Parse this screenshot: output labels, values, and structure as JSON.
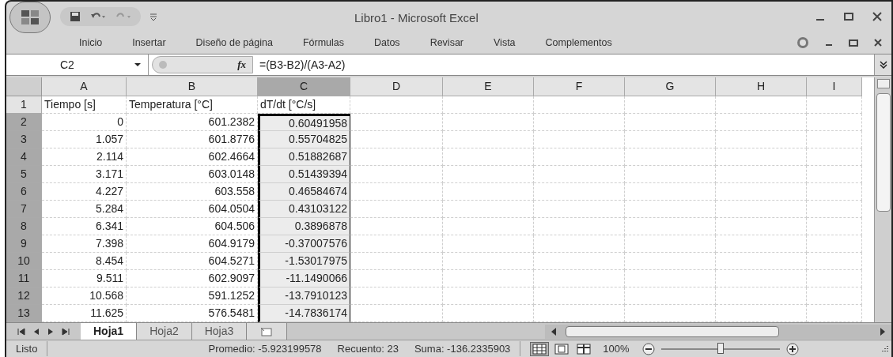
{
  "window": {
    "title": "Libro1 - Microsoft Excel"
  },
  "ribbon_tabs": [
    {
      "label": "Inicio"
    },
    {
      "label": "Insertar"
    },
    {
      "label": "Diseño de página"
    },
    {
      "label": "Fórmulas"
    },
    {
      "label": "Datos"
    },
    {
      "label": "Revisar"
    },
    {
      "label": "Vista"
    },
    {
      "label": "Complementos"
    }
  ],
  "formula_bar": {
    "name_box": "C2",
    "fx": "fx",
    "formula": "=(B3-B2)/(A3-A2)"
  },
  "columns": [
    {
      "label": "A",
      "selected": false
    },
    {
      "label": "B",
      "selected": false
    },
    {
      "label": "C",
      "selected": true
    },
    {
      "label": "D",
      "selected": false
    },
    {
      "label": "E",
      "selected": false
    },
    {
      "label": "F",
      "selected": false
    },
    {
      "label": "G",
      "selected": false
    },
    {
      "label": "H",
      "selected": false
    },
    {
      "label": "I",
      "selected": false
    }
  ],
  "rows": [
    {
      "label": "1",
      "selected": false,
      "cells": [
        {
          "text": "Tiempo [s]",
          "kind": "text"
        },
        {
          "text": "Temperatura [°C]",
          "kind": "text"
        },
        {
          "text": "dT/dt [°C/s]",
          "kind": "text"
        }
      ]
    },
    {
      "label": "2",
      "selected": true,
      "cells": [
        {
          "text": "0",
          "kind": "number"
        },
        {
          "text": "601.2382",
          "kind": "number"
        },
        {
          "text": "0.60491958",
          "kind": "number"
        }
      ]
    },
    {
      "label": "3",
      "selected": true,
      "cells": [
        {
          "text": "1.057",
          "kind": "number"
        },
        {
          "text": "601.8776",
          "kind": "number"
        },
        {
          "text": "0.55704825",
          "kind": "number"
        }
      ]
    },
    {
      "label": "4",
      "selected": true,
      "cells": [
        {
          "text": "2.114",
          "kind": "number"
        },
        {
          "text": "602.4664",
          "kind": "number"
        },
        {
          "text": "0.51882687",
          "kind": "number"
        }
      ]
    },
    {
      "label": "5",
      "selected": true,
      "cells": [
        {
          "text": "3.171",
          "kind": "number"
        },
        {
          "text": "603.0148",
          "kind": "number"
        },
        {
          "text": "0.51439394",
          "kind": "number"
        }
      ]
    },
    {
      "label": "6",
      "selected": true,
      "cells": [
        {
          "text": "4.227",
          "kind": "number"
        },
        {
          "text": "603.558",
          "kind": "number"
        },
        {
          "text": "0.46584674",
          "kind": "number"
        }
      ]
    },
    {
      "label": "7",
      "selected": true,
      "cells": [
        {
          "text": "5.284",
          "kind": "number"
        },
        {
          "text": "604.0504",
          "kind": "number"
        },
        {
          "text": "0.43103122",
          "kind": "number"
        }
      ]
    },
    {
      "label": "8",
      "selected": true,
      "cells": [
        {
          "text": "6.341",
          "kind": "number"
        },
        {
          "text": "604.506",
          "kind": "number"
        },
        {
          "text": "0.3896878",
          "kind": "number"
        }
      ]
    },
    {
      "label": "9",
      "selected": true,
      "cells": [
        {
          "text": "7.398",
          "kind": "number"
        },
        {
          "text": "604.9179",
          "kind": "number"
        },
        {
          "text": "-0.37007576",
          "kind": "number"
        }
      ]
    },
    {
      "label": "10",
      "selected": true,
      "cells": [
        {
          "text": "8.454",
          "kind": "number"
        },
        {
          "text": "604.5271",
          "kind": "number"
        },
        {
          "text": "-1.53017975",
          "kind": "number"
        }
      ]
    },
    {
      "label": "11",
      "selected": true,
      "cells": [
        {
          "text": "9.511",
          "kind": "number"
        },
        {
          "text": "602.9097",
          "kind": "number"
        },
        {
          "text": "-11.1490066",
          "kind": "number"
        }
      ]
    },
    {
      "label": "12",
      "selected": true,
      "cells": [
        {
          "text": "10.568",
          "kind": "number"
        },
        {
          "text": "591.1252",
          "kind": "number"
        },
        {
          "text": "-13.7910123",
          "kind": "number"
        }
      ]
    },
    {
      "label": "13",
      "selected": true,
      "cells": [
        {
          "text": "11.625",
          "kind": "number"
        },
        {
          "text": "576.5481",
          "kind": "number"
        },
        {
          "text": "-14.7836174",
          "kind": "number"
        }
      ]
    }
  ],
  "sheet_tabs": [
    {
      "label": "Hoja1",
      "selected": true
    },
    {
      "label": "Hoja2",
      "selected": false
    },
    {
      "label": "Hoja3",
      "selected": false
    }
  ],
  "status_bar": {
    "mode": "Listo",
    "average": "Promedio: -5.923199578",
    "count": "Recuento: 23",
    "sum": "Suma: -136.2335903",
    "views": [
      {
        "kind": "normal",
        "selected": true
      },
      {
        "kind": "layout",
        "selected": false
      },
      {
        "kind": "pagebreak",
        "selected": false
      }
    ],
    "zoom": "100%",
    "zoom_slider": {
      "level": 0.5
    }
  }
}
